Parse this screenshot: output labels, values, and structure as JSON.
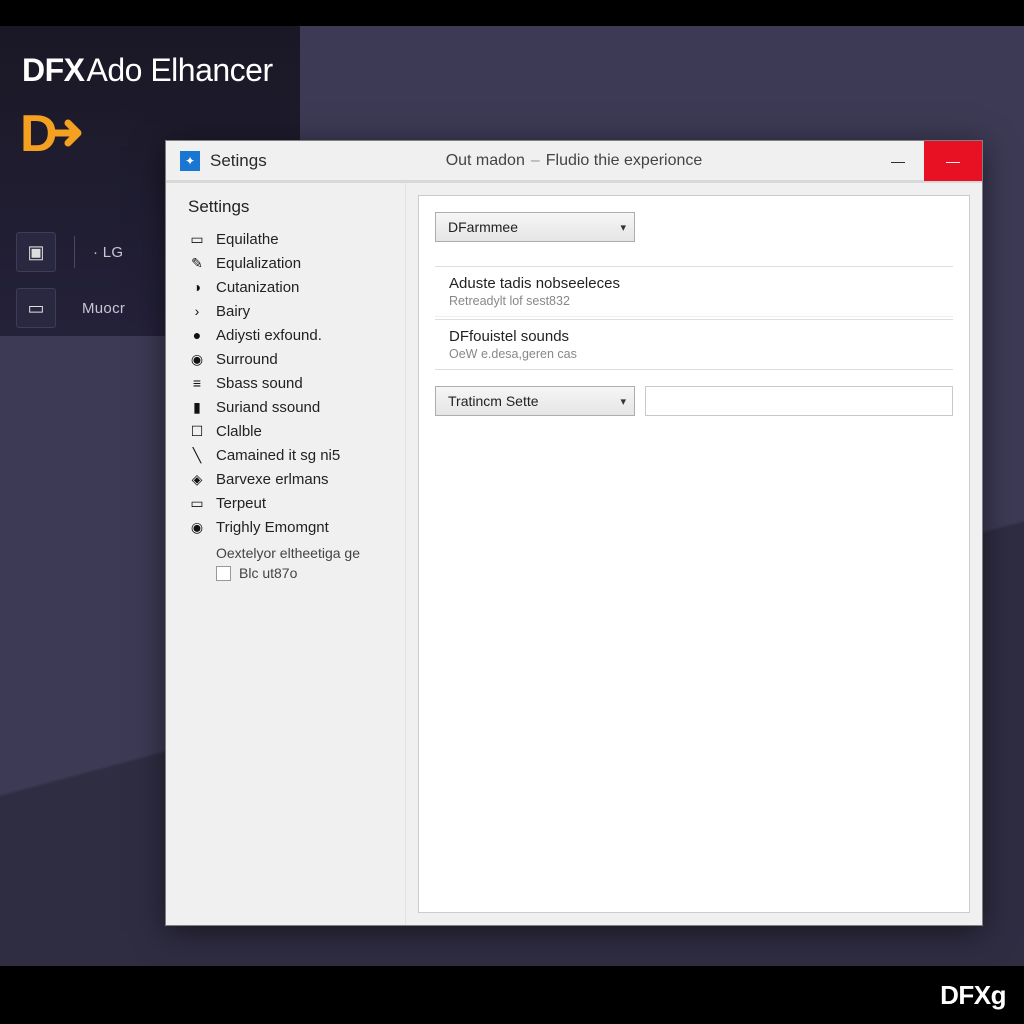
{
  "app": {
    "title_bold": "DFX",
    "title_light": "Ado Elhancer",
    "logo_text": "D",
    "toolbar_1_label": "· LG",
    "toolbar_2_label": "Muocr"
  },
  "window": {
    "title": "Setings",
    "subtitle_left": "Out madon",
    "subtitle_right": "Fludio thie experionce",
    "minimize": "—",
    "close": "—"
  },
  "sidebar": {
    "heading": "Settings",
    "items": [
      {
        "icon": "▭",
        "label": "Equilathe"
      },
      {
        "icon": "✎",
        "label": "Equlalization"
      },
      {
        "icon": "◑",
        "label": "Cutanization"
      },
      {
        "icon": "›",
        "label": "Bairy"
      },
      {
        "icon": "●",
        "label": "Adiysti exfound."
      },
      {
        "icon": "◉",
        "label": "Surround"
      },
      {
        "icon": "≡",
        "label": "Sbass sound"
      },
      {
        "icon": "▮",
        "label": "Suriand ssound"
      },
      {
        "icon": "☐",
        "label": "Clalble"
      },
      {
        "icon": "╲",
        "label": "Camained it sg ni5"
      },
      {
        "icon": "◈",
        "label": "Barvexe erlmans"
      },
      {
        "icon": "▭",
        "label": "Terpeut"
      },
      {
        "icon": "◉",
        "label": "Trighly Emomgnt"
      }
    ],
    "subtext": "Oextelyor eltheetiga ge",
    "checkbox_label": "Blc ut87o"
  },
  "content": {
    "dropdown1": "DFarmmee",
    "panel1_h": "Aduste tadis nobseeleces",
    "panel1_s": "Retreadylt lof sest832",
    "panel2_h": "DFfouistel sounds",
    "panel2_s": "OeW e.desa,geren cas",
    "dropdown2": "Tratincm Sette"
  },
  "footer": {
    "brand": "DFXg"
  }
}
